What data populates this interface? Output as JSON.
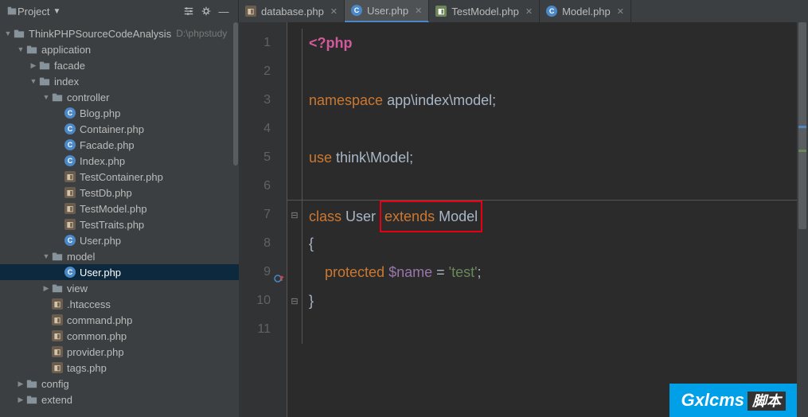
{
  "project_panel": {
    "title": "Project",
    "root": "ThinkPHPSourceCodeAnalysis",
    "root_path": "D:\\phpstudy"
  },
  "tree": [
    {
      "depth": 0,
      "arrow": "down",
      "icon": "folder",
      "label": "ThinkPHPSourceCodeAnalysis",
      "path": "D:\\phpstudy"
    },
    {
      "depth": 1,
      "arrow": "down",
      "icon": "folder",
      "label": "application"
    },
    {
      "depth": 2,
      "arrow": "right",
      "icon": "folder",
      "label": "facade"
    },
    {
      "depth": 2,
      "arrow": "down",
      "icon": "folder",
      "label": "index"
    },
    {
      "depth": 3,
      "arrow": "down",
      "icon": "folder",
      "label": "controller"
    },
    {
      "depth": 4,
      "arrow": "none",
      "icon": "php-blue",
      "label": "Blog.php"
    },
    {
      "depth": 4,
      "arrow": "none",
      "icon": "php-blue",
      "label": "Container.php"
    },
    {
      "depth": 4,
      "arrow": "none",
      "icon": "php-blue",
      "label": "Facade.php"
    },
    {
      "depth": 4,
      "arrow": "none",
      "icon": "php-blue",
      "label": "Index.php"
    },
    {
      "depth": 4,
      "arrow": "none",
      "icon": "php-brown",
      "label": "TestContainer.php"
    },
    {
      "depth": 4,
      "arrow": "none",
      "icon": "php-brown",
      "label": "TestDb.php"
    },
    {
      "depth": 4,
      "arrow": "none",
      "icon": "php-brown",
      "label": "TestModel.php"
    },
    {
      "depth": 4,
      "arrow": "none",
      "icon": "php-brown",
      "label": "TestTraits.php"
    },
    {
      "depth": 4,
      "arrow": "none",
      "icon": "php-blue",
      "label": "User.php"
    },
    {
      "depth": 3,
      "arrow": "down",
      "icon": "folder",
      "label": "model"
    },
    {
      "depth": 4,
      "arrow": "none",
      "icon": "php-blue",
      "label": "User.php",
      "selected": true
    },
    {
      "depth": 3,
      "arrow": "right",
      "icon": "folder",
      "label": "view"
    },
    {
      "depth": 3,
      "arrow": "none",
      "icon": "php-brown",
      "label": ".htaccess"
    },
    {
      "depth": 3,
      "arrow": "none",
      "icon": "php-brown",
      "label": "command.php"
    },
    {
      "depth": 3,
      "arrow": "none",
      "icon": "php-brown",
      "label": "common.php"
    },
    {
      "depth": 3,
      "arrow": "none",
      "icon": "php-brown",
      "label": "provider.php"
    },
    {
      "depth": 3,
      "arrow": "none",
      "icon": "php-brown",
      "label": "tags.php"
    },
    {
      "depth": 1,
      "arrow": "right",
      "icon": "folder",
      "label": "config"
    },
    {
      "depth": 1,
      "arrow": "right",
      "icon": "folder",
      "label": "extend"
    }
  ],
  "tabs": [
    {
      "icon": "php-brown",
      "label": "database.php",
      "active": false
    },
    {
      "icon": "php-blue",
      "label": "User.php",
      "active": true
    },
    {
      "icon": "php-green",
      "label": "TestModel.php",
      "active": false
    },
    {
      "icon": "php-blue",
      "label": "Model.php",
      "active": false
    }
  ],
  "code": {
    "lines": [
      "1",
      "2",
      "3",
      "4",
      "5",
      "6",
      "7",
      "8",
      "9",
      "10",
      "11"
    ],
    "l1_open": "<?php",
    "l3_ns": "namespace",
    "l3_path": " app\\index\\model;",
    "l5_use": "use",
    "l5_path": " think\\Model;",
    "l7_class": "class",
    "l7_name": " User ",
    "l7_extends": "extends",
    "l7_parent": " Model",
    "l8_brace": "{",
    "l9_protected": "protected",
    "l9_var": " $name",
    "l9_eq": " = ",
    "l9_str": "'test'",
    "l9_semi": ";",
    "l10_brace": "}"
  },
  "watermark": {
    "brand": "Gxl",
    "cms": "cms",
    "cn": "脚本"
  }
}
